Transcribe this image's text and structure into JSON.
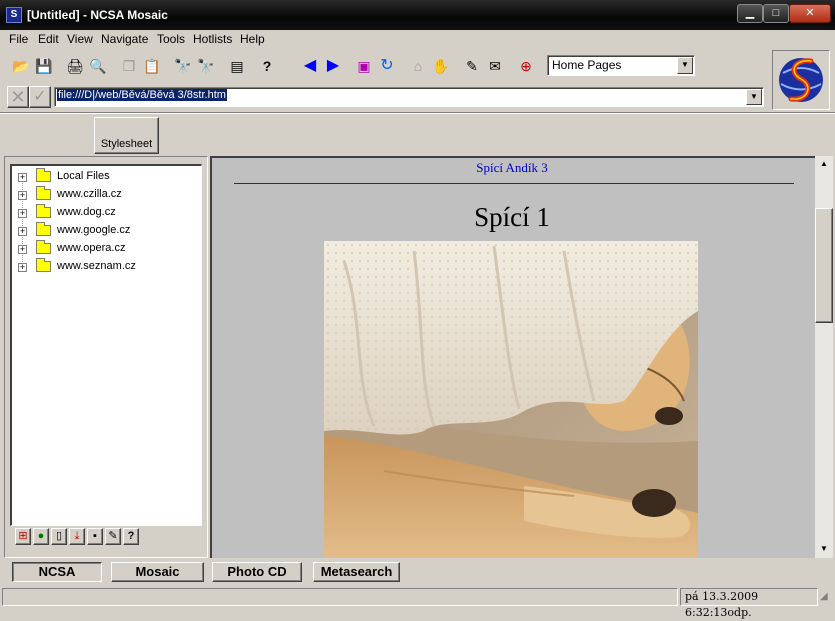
{
  "window": {
    "title": "[Untitled] - NCSA Mosaic",
    "minimize_icon": "minimize-icon",
    "maximize_icon": "maximize-icon",
    "close_icon": "close-icon"
  },
  "menu": [
    "File",
    "Edit",
    "View",
    "Navigate",
    "Tools",
    "Hotlists",
    "Help"
  ],
  "toolbar": {
    "home_pages": "Home Pages",
    "icons": [
      "open-folder-icon",
      "save-icon",
      "print-icon",
      "print-preview-icon",
      "copy-icon",
      "paste-icon",
      "find-icon",
      "find-next-icon",
      "document-info-icon",
      "help-icon",
      "back-icon",
      "forward-icon",
      "load-images-icon",
      "reload-icon",
      "home-icon",
      "stop-icon",
      "annotate-icon",
      "mail-icon",
      "add-hotlist-icon"
    ]
  },
  "address": {
    "url": "file:///D|/web/Běvá/Běvá 3/8str.htm"
  },
  "stylesheet_button": "Stylesheet",
  "tree": {
    "items": [
      "Local Files",
      "www.czilla.cz",
      "www.dog.cz",
      "www.google.cz",
      "www.opera.cz",
      "www.seznam.cz"
    ]
  },
  "page": {
    "link": "Spící Andík 3",
    "heading": "Spící 1"
  },
  "bottom_buttons": [
    "NCSA",
    "Mosaic",
    "Photo CD",
    "Metasearch"
  ],
  "status": {
    "datetime": "pá 13.3.2009 6:32:13odp."
  },
  "colors": {
    "link": "#0000cc",
    "selection": "#0a246a"
  }
}
